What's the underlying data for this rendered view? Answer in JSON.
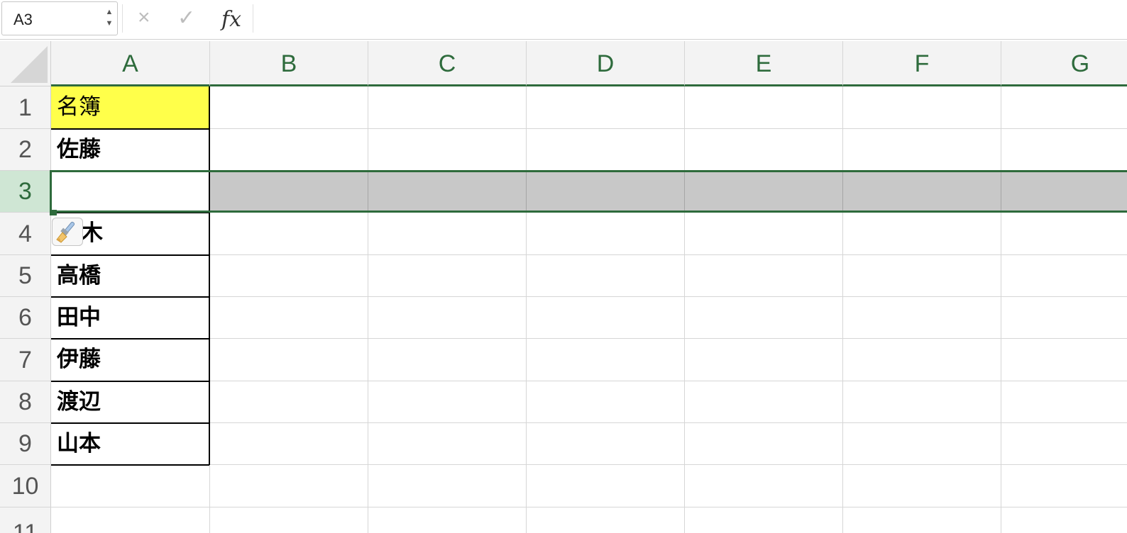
{
  "formula_bar": {
    "name_box": "A3",
    "stepper": "▲▼",
    "cancel_icon": "×",
    "enter_icon": "✓",
    "fx_label": "fx",
    "formula": ""
  },
  "columns": [
    "A",
    "B",
    "C",
    "D",
    "E",
    "F",
    "G"
  ],
  "rows": [
    "1",
    "2",
    "3",
    "4",
    "5",
    "6",
    "7",
    "8",
    "9",
    "10",
    "11"
  ],
  "selected_row": "3",
  "active_cell": "A3",
  "cells_A": [
    "名簿",
    "佐藤",
    "",
    "木",
    "高橋",
    "田中",
    "伊藤",
    "渡辺",
    "山本",
    "",
    ""
  ],
  "colors": {
    "accent": "#2e6b3c",
    "header_highlight": "#ffff4a",
    "selected_row_fill": "#c8c8c8"
  },
  "icons": {
    "paste_options": "paintbrush-icon"
  }
}
